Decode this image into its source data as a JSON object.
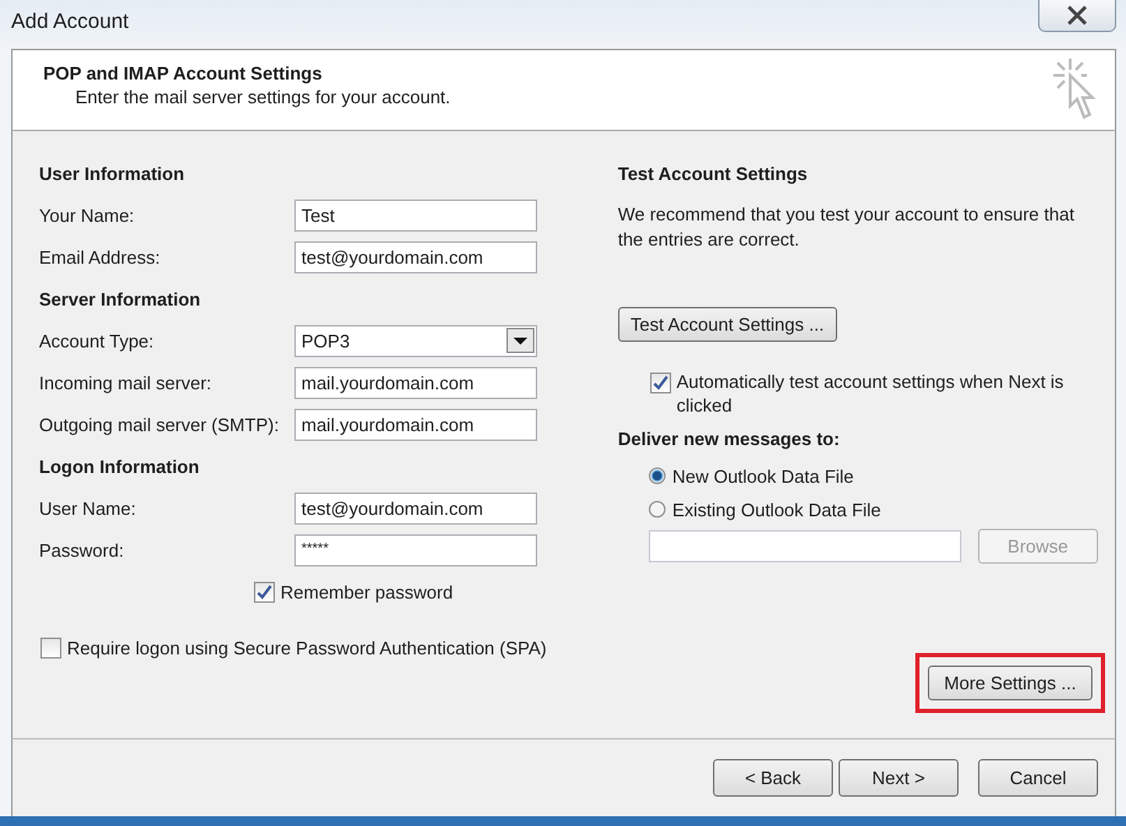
{
  "window": {
    "title": "Add Account"
  },
  "header": {
    "title": "POP and IMAP Account Settings",
    "subtitle": "Enter the mail server settings for your account."
  },
  "sections": [
    {
      "heading": "User Information",
      "rows": [
        {
          "label": "Your Name:",
          "kind": "text",
          "value": "Test"
        },
        {
          "label": "Email Address:",
          "kind": "text",
          "value": "test@yourdomain.com"
        }
      ]
    },
    {
      "heading": "Server Information",
      "rows": [
        {
          "label": "Account Type:",
          "kind": "dropdown",
          "value": "POP3"
        },
        {
          "label": "Incoming mail server:",
          "kind": "text",
          "value": "mail.yourdomain.com"
        },
        {
          "label": "Outgoing mail server (SMTP):",
          "kind": "text",
          "value": "mail.yourdomain.com"
        }
      ]
    },
    {
      "heading": "Logon Information",
      "rows": [
        {
          "label": "User Name:",
          "kind": "text",
          "value": "test@yourdomain.com"
        },
        {
          "label": "Password:",
          "kind": "password",
          "value": "*****"
        }
      ]
    }
  ],
  "remember_password": {
    "label": "Remember password",
    "checked": true
  },
  "spa": {
    "label": "Require logon using Secure Password Authentication (SPA)",
    "checked": false
  },
  "test": {
    "heading": "Test Account Settings",
    "description": "We recommend that you test your account to ensure that the entries are correct.",
    "button": "Test Account Settings ...",
    "auto_test": {
      "label": "Automatically test account settings when Next is clicked",
      "checked": true
    }
  },
  "deliver": {
    "heading": "Deliver new messages to:",
    "options": [
      {
        "label": "New Outlook Data File",
        "selected": true
      },
      {
        "label": "Existing Outlook Data File",
        "selected": false
      }
    ],
    "browse": {
      "label": "Browse",
      "disabled": true
    }
  },
  "more_settings": {
    "label": "More Settings ...",
    "highlighted": true
  },
  "footer_buttons": [
    {
      "label": "< Back"
    },
    {
      "label": "Next >"
    },
    {
      "label": "Cancel"
    }
  ]
}
